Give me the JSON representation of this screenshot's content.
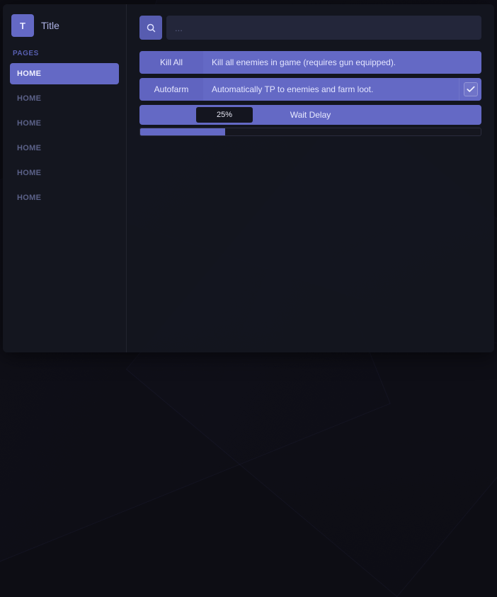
{
  "title": {
    "badge": "T",
    "text": "Title"
  },
  "sidebar": {
    "section_label": "PAGES",
    "items": [
      {
        "label": "HOME",
        "active": true
      },
      {
        "label": "HOME",
        "active": false
      },
      {
        "label": "HOME",
        "active": false
      },
      {
        "label": "HOME",
        "active": false
      },
      {
        "label": "HOME",
        "active": false
      },
      {
        "label": "HOME",
        "active": false
      }
    ]
  },
  "search": {
    "placeholder": "..."
  },
  "actions": {
    "kill_all": {
      "label": "Kill All",
      "desc": "Kill all enemies in game (requires gun equipped)."
    },
    "autofarm": {
      "label": "Autofarm",
      "desc": "Automatically TP to enemies and farm loot.",
      "checked": true
    }
  },
  "slider": {
    "title": "Wait Delay",
    "value_text": "25%",
    "percent": 25
  }
}
